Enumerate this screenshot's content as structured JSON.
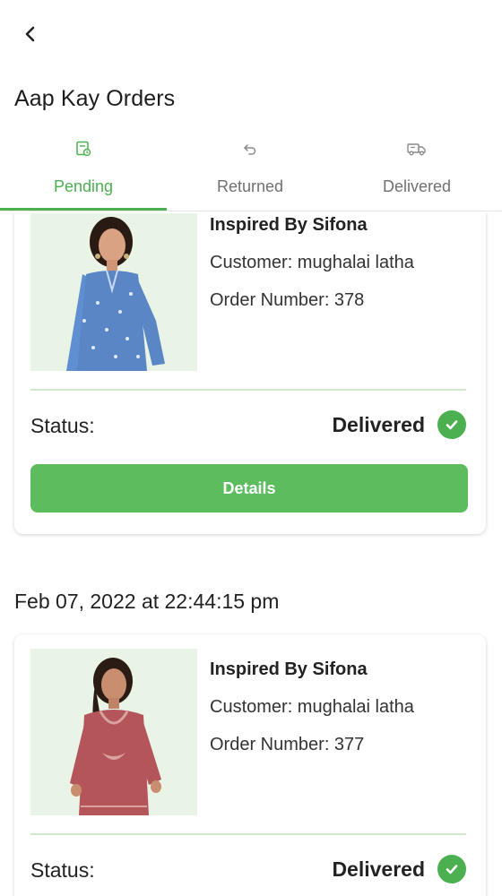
{
  "app": {
    "title": "Aap Kay Orders"
  },
  "tabs": [
    {
      "label": "Pending",
      "icon": "pending-orders-icon",
      "active": true
    },
    {
      "label": "Returned",
      "icon": "return-arrow-icon",
      "active": false
    },
    {
      "label": "Delivered",
      "icon": "delivery-truck-icon",
      "active": false
    }
  ],
  "orders": [
    {
      "product": "Inspired By Sifona",
      "customer": "Customer: mughalai latha",
      "order_number": "Order Number: 378",
      "status_label": "Status:",
      "status_value": "Delivered",
      "details_label": "Details"
    },
    {
      "date": "Feb 07, 2022 at 22:44:15 pm",
      "product": "Inspired By Sifona",
      "customer": "Customer: mughalai latha",
      "order_number": "Order Number: 377",
      "status_label": "Status:",
      "status_value": "Delivered"
    }
  ],
  "colors": {
    "accent": "#4caf50",
    "button": "#5cbd5f",
    "thumb_bg": "#e9f3e6"
  }
}
